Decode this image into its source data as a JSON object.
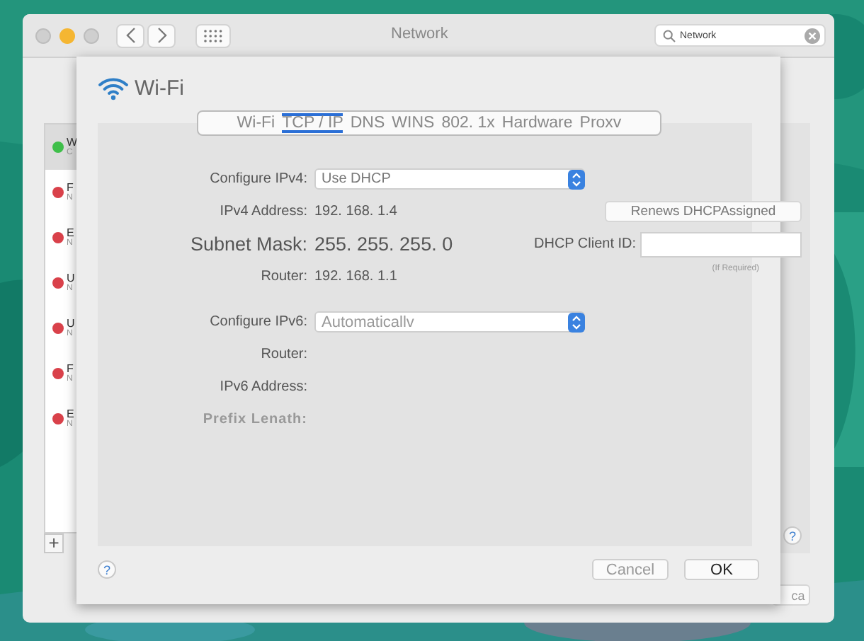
{
  "window": {
    "title": "Network",
    "search": {
      "value": "Network"
    }
  },
  "sidebar": {
    "items": [
      {
        "letter": "W",
        "sub": "C",
        "selected": true,
        "color": "#3fbf4a"
      },
      {
        "letter": "F",
        "sub": "N",
        "selected": false,
        "color": "#d9414a"
      },
      {
        "letter": "E",
        "sub": "N",
        "selected": false,
        "color": "#d9414a"
      },
      {
        "letter": "U",
        "sub": "N",
        "selected": false,
        "color": "#d9414a"
      },
      {
        "letter": "U",
        "sub": "N",
        "selected": false,
        "color": "#d9414a"
      },
      {
        "letter": "F",
        "sub": "N",
        "selected": false,
        "color": "#d9414a"
      },
      {
        "letter": "E",
        "sub": "N",
        "selected": false,
        "color": "#d9414a"
      }
    ],
    "add_button": "+"
  },
  "right_button": "ca",
  "right_help": "?",
  "sheet": {
    "title": "Wi-Fi",
    "tabs": [
      {
        "label": "Wi-Fi",
        "selected": false
      },
      {
        "label": "TCP / IP",
        "selected": true
      },
      {
        "label": "DNS",
        "selected": false
      },
      {
        "label": "WINS",
        "selected": false
      },
      {
        "label": "802. 1x",
        "selected": false
      },
      {
        "label": "Hardware",
        "selected": false
      },
      {
        "label": "Proxv",
        "selected": false
      }
    ],
    "ipv4": {
      "configure_label": "Configure IPv4:",
      "configure_value": "Use DHCP",
      "rows": [
        {
          "label": "IPv4 Address:",
          "value": "192. 168. 1.4"
        },
        {
          "label": "Subnet Mask:",
          "value": "255. 255. 255. 0"
        },
        {
          "label": "Router:",
          "value": "192. 168. 1.1"
        }
      ],
      "renew_button": "Renews DHCPAssigned",
      "client_id_label": "DHCP Client ID:",
      "client_id_hint": "(If Required)"
    },
    "ipv6": {
      "configure_label": "Configure IPv6:",
      "configure_value": "Automaticallv",
      "rows": [
        {
          "label": "Router:"
        },
        {
          "label": "IPv6 Address:"
        },
        {
          "label": "Prefix Lenath:"
        }
      ]
    },
    "help": "?",
    "buttons": [
      {
        "label": "Cancel",
        "kind": "secondary"
      },
      {
        "label": "OK",
        "kind": "primary"
      }
    ]
  }
}
